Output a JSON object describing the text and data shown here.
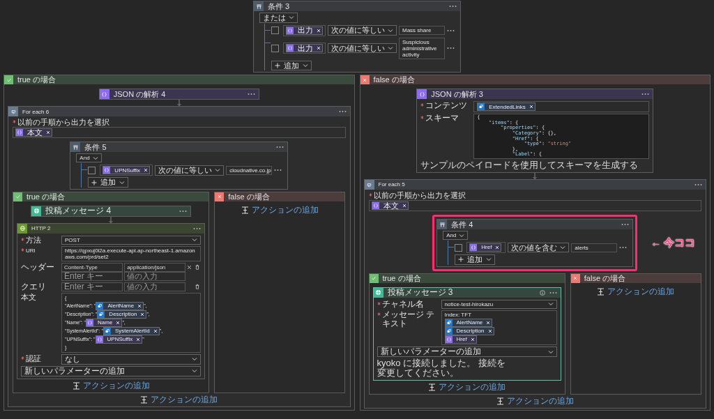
{
  "condition": {
    "title": "条件 3",
    "operator": "または",
    "add_label": "追加",
    "rows": [
      {
        "checked": false,
        "token": {
          "kind": "json",
          "label": "出力"
        },
        "comparison": "次の値に等しい",
        "value": "Mass share"
      },
      {
        "checked": false,
        "token": {
          "kind": "json",
          "label": "出力"
        },
        "comparison": "次の値に等しい",
        "value": "Suspicious administrative activity"
      }
    ],
    "branches": [
      {
        "kind": "true",
        "title": "true の場合",
        "steps": [
          {
            "kind": "json_parse",
            "title": "JSON の解析 4"
          },
          {
            "kind": "foreach",
            "title": "For each 6",
            "field_label": "以前の手順から出力を選択",
            "tokens": [
              {
                "kind": "json",
                "label": "本文"
              }
            ],
            "add_action": "アクションの追加",
            "steps": [
              {
                "kind": "condition",
                "title": "条件 5",
                "operator": "And",
                "add_label": "追加",
                "rows": [
                  {
                    "checked": false,
                    "token": {
                      "kind": "json",
                      "label": "UPNSuffix"
                    },
                    "comparison": "次の値に等しい",
                    "value": "cloudnative.co.jp"
                  }
                ],
                "branches": [
                  {
                    "kind": "true",
                    "title": "true の場合",
                    "add_action": "アクションの追加",
                    "steps": [
                      {
                        "kind": "post_message",
                        "title": "投稿メッセージ 4"
                      },
                      {
                        "kind": "http",
                        "title": "HTTP 2",
                        "selected": false,
                        "fields": [
                          {
                            "kind": "select",
                            "label": "方法",
                            "required": true,
                            "value": "POST"
                          },
                          {
                            "kind": "text",
                            "label": "URI",
                            "required": true,
                            "value": "https://qpxuj0i2a.execute-api.ap-northeast-1.amazonaws.com/prd/set2"
                          },
                          {
                            "kind": "pairs",
                            "label": "ヘッダー",
                            "required": false,
                            "rows": [
                              {
                                "key": "Content-Type",
                                "value": "application/json"
                              },
                              {
                                "key_placeholder": "Enter キー",
                                "value_placeholder": "値の入力"
                              }
                            ]
                          },
                          {
                            "kind": "pairs",
                            "label": "クエリ",
                            "required": false,
                            "rows": [
                              {
                                "key_placeholder": "Enter キー",
                                "value_placeholder": "値の入力"
                              }
                            ]
                          },
                          {
                            "kind": "body",
                            "label": "本文",
                            "required": false,
                            "lines": [
                              {
                                "text": "{"
                              },
                              {
                                "text": "\"AlertName\": \"",
                                "token": {
                                  "kind": "defender",
                                  "label": "AlertName"
                                },
                                "after": "\","
                              },
                              {
                                "text": "\"Description\": \"",
                                "token": {
                                  "kind": "defender",
                                  "label": "Description"
                                },
                                "after": "\","
                              },
                              {
                                "text": "\"Name\": \"",
                                "token": {
                                  "kind": "json",
                                  "label": "Name"
                                },
                                "after": "\","
                              },
                              {
                                "text": "\"SystemAlertId\": \"",
                                "token": {
                                  "kind": "defender",
                                  "label": "SystemAlertId"
                                },
                                "after": "\","
                              },
                              {
                                "text": "\"UPNSuffix\": \"",
                                "token": {
                                  "kind": "json",
                                  "label": "UPNSuffix"
                                },
                                "after": "\""
                              },
                              {
                                "text": "}"
                              }
                            ]
                          },
                          {
                            "kind": "select",
                            "label": "認証",
                            "required": true,
                            "value": "なし"
                          },
                          {
                            "kind": "add_param",
                            "value": "新しいパラメーターの追加"
                          }
                        ]
                      }
                    ]
                  },
                  {
                    "kind": "false",
                    "title": "false の場合",
                    "add_action": "アクションの追加"
                  }
                ]
              }
            ]
          }
        ]
      },
      {
        "kind": "false",
        "title": "false の場合",
        "steps": [
          {
            "kind": "json_parse",
            "title": "JSON の解析 3",
            "selected": false,
            "fields": [
              {
                "kind": "tokens",
                "label": "コンテンツ",
                "required": true,
                "tokens": [
                  {
                    "kind": "defender",
                    "label": "ExtendedLinks"
                  }
                ]
              },
              {
                "kind": "code",
                "label": "スキーマ",
                "required": true,
                "lines": [
                  "{",
                  "    \"items\": {",
                  "        \"properties\": {",
                  "            \"Category\": {},",
                  "            \"Href\": {",
                  "                \"type\": \"string\"",
                  "            },",
                  "            \"Label\": {"
                ]
              }
            ],
            "note": "サンプルのペイロードを使用してスキーマを生成する"
          },
          {
            "kind": "foreach",
            "title": "For each 5",
            "field_label": "以前の手順から出力を選択",
            "tokens": [
              {
                "kind": "json",
                "label": "本文"
              }
            ],
            "add_action": "アクションの追加",
            "steps": [
              {
                "kind": "condition",
                "title": "条件 4",
                "operator": "And",
                "add_label": "追加",
                "highlighted": true,
                "callout": "← 今ココ",
                "rows": [
                  {
                    "checked": false,
                    "token": {
                      "kind": "json",
                      "label": "Href"
                    },
                    "comparison": "次の値を含む",
                    "value": "alerts"
                  }
                ],
                "branches": [
                  {
                    "kind": "true",
                    "title": "true の場合",
                    "add_action": "アクションの追加",
                    "steps": [
                      {
                        "kind": "post_message",
                        "title": "投稿メッセージ 3",
                        "selected": true,
                        "fields": [
                          {
                            "kind": "select",
                            "label": "チャネル名",
                            "required": true,
                            "value": "notice-test-hirokazu"
                          },
                          {
                            "kind": "message",
                            "label": "メッセージ テキスト",
                            "required": true,
                            "text": "Index: TFT",
                            "tokens": [
                              {
                                "kind": "defender",
                                "label": "AlertName"
                              },
                              {
                                "kind": "defender",
                                "label": "Description"
                              },
                              {
                                "kind": "json",
                                "label": "Href"
                              }
                            ]
                          },
                          {
                            "kind": "add_param",
                            "value": "新しいパラメーターの追加"
                          }
                        ],
                        "note": "kyoko に接続しました。 接続を変更してください。"
                      }
                    ]
                  },
                  {
                    "kind": "false",
                    "title": "false の場合",
                    "add_action": "アクションの追加"
                  }
                ]
              }
            ]
          }
        ]
      }
    ]
  }
}
